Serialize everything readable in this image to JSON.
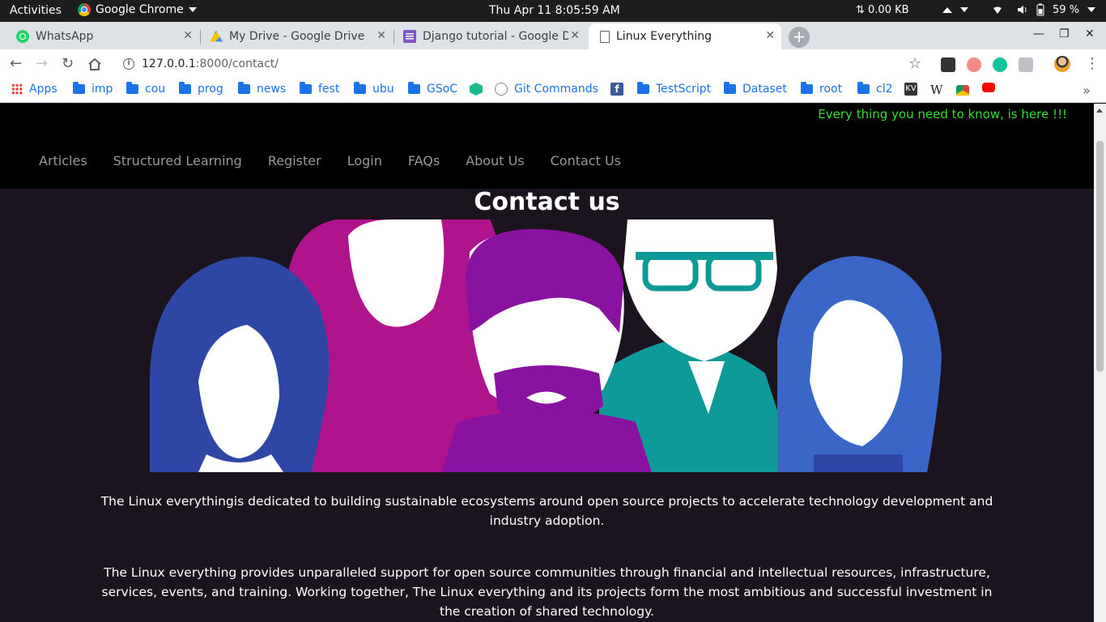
{
  "os_bar": {
    "activities": "Activities",
    "app_name": "Google Chrome",
    "clock": "Thu Apr 11   8:05:59 AM",
    "network": "⇅ 0.00 KB",
    "battery": "59 %"
  },
  "tabs": [
    {
      "title": "WhatsApp",
      "favicon": "whatsapp-icon"
    },
    {
      "title": "My Drive - Google Drive",
      "favicon": "google-drive-icon"
    },
    {
      "title": "Django tutorial - Google D",
      "favicon": "google-docs-icon"
    },
    {
      "title": "Linux Everything",
      "favicon": "page-icon",
      "active": true
    }
  ],
  "address_bar": {
    "host": "127.0.0.1",
    "path": ":8000/contact/"
  },
  "bookmarks": [
    {
      "label": "Apps",
      "icon": "apps-grid-icon"
    },
    {
      "label": "imp",
      "icon": "folder-icon"
    },
    {
      "label": "cou",
      "icon": "folder-icon"
    },
    {
      "label": "prog",
      "icon": "folder-icon"
    },
    {
      "label": "news",
      "icon": "folder-icon"
    },
    {
      "label": "fest",
      "icon": "folder-icon"
    },
    {
      "label": "ubu",
      "icon": "folder-icon"
    },
    {
      "label": "GSoC",
      "icon": "folder-icon"
    },
    {
      "label": "",
      "icon": "hex-icon"
    },
    {
      "label": "Git Commands",
      "icon": "git-icon"
    },
    {
      "label": "",
      "icon": "facebook-icon"
    },
    {
      "label": "TestScript",
      "icon": "folder-icon"
    },
    {
      "label": "Dataset",
      "icon": "folder-icon"
    },
    {
      "label": "root",
      "icon": "folder-icon"
    },
    {
      "label": "cl2",
      "icon": "folder-icon"
    },
    {
      "label": "KV",
      "icon": "kv-icon"
    },
    {
      "label": "W",
      "icon": "wikipedia-icon"
    },
    {
      "label": "",
      "icon": "chrome-web-store-icon"
    },
    {
      "label": "",
      "icon": "youtube-icon"
    },
    {
      "label": "»",
      "icon": "overflow-chevron-icon"
    }
  ],
  "site": {
    "tagline": "Every thing you need to know, is here !!!",
    "nav": [
      "Articles",
      "Structured Learning",
      "Register",
      "Login",
      "FAQs",
      "About Us",
      "Contact Us"
    ],
    "heading": "Contact us",
    "paragraph1": "The Linux everythingis dedicated to building sustainable ecosystems around open source projects to accelerate technology development and industry adoption.",
    "paragraph2": "The Linux everything provides unparalleled support for open source communities through financial and intellectual resources, infrastructure, services, events, and training. Working together, The Linux everything and its projects form the most ambitious and successful investment in the creation of shared technology."
  },
  "colors": {
    "tagline": "#33dd33",
    "page_bg": "#1b141f",
    "header_bg": "#000000",
    "nav_text": "#999999"
  }
}
